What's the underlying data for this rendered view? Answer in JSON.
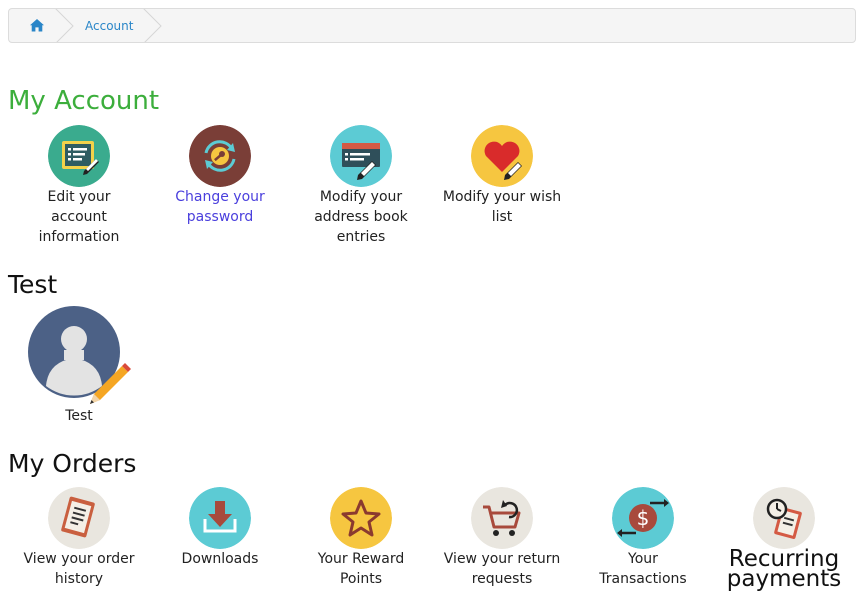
{
  "breadcrumb": {
    "home_icon": "home-icon",
    "items": [
      {
        "label": "Account"
      }
    ]
  },
  "sections": {
    "my_account": {
      "title": "My Account",
      "items": [
        {
          "label": "Edit your account information",
          "icon": "edit-account-icon",
          "color": "#3aab8e"
        },
        {
          "label": "Change your password",
          "icon": "change-password-icon",
          "color": "#7a3e37"
        },
        {
          "label": "Modify your address book entries",
          "icon": "address-book-icon",
          "color": "#5ccbd4"
        },
        {
          "label": "Modify your wish list",
          "icon": "wish-list-icon",
          "color": "#f6c640"
        }
      ]
    },
    "profile": {
      "title": "Test",
      "name": "Test",
      "avatar_icon": "avatar-icon",
      "color": "#4c6186"
    },
    "my_orders": {
      "title": "My Orders",
      "items": [
        {
          "label": "View your order history",
          "icon": "order-history-icon",
          "color": "#e9e6df"
        },
        {
          "label": "Downloads",
          "icon": "downloads-icon",
          "color": "#5ccbd4"
        },
        {
          "label": "Your Reward Points",
          "icon": "reward-points-icon",
          "color": "#f6c640"
        },
        {
          "label": "View your return requests",
          "icon": "return-requests-icon",
          "color": "#e9e6df"
        },
        {
          "label": "Your Transactions",
          "icon": "transactions-icon",
          "color": "#5ccbd4"
        },
        {
          "label": "Recurring payments",
          "icon": "recurring-payments-icon",
          "color": "#e9e6df"
        }
      ]
    }
  },
  "colors": {
    "accent": "#3cae3c",
    "link": "#4a3fdd",
    "breadcrumb_link": "#2a86c8"
  }
}
